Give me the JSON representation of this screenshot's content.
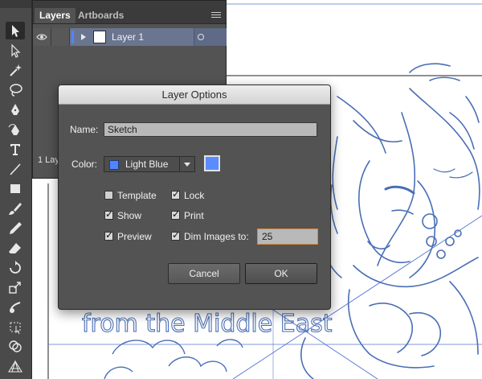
{
  "colors": {
    "accent": "#4f86ff",
    "sketch": "#4a6fb5",
    "panel_bg": "#535353",
    "layer_row": "#6a7590"
  },
  "tools_panel": {
    "tools": [
      "selection-tool-icon",
      "direct-selection-tool-icon",
      "magic-wand-tool-icon",
      "lasso-tool-icon",
      "pen-tool-icon",
      "curvature-pen-tool-icon",
      "type-tool-icon",
      "line-tool-icon",
      "rectangle-tool-icon",
      "paintbrush-tool-icon",
      "pencil-tool-icon",
      "eraser-tool-icon",
      "rotate-tool-icon",
      "scale-tool-icon",
      "warp-tool-icon",
      "free-transform-tool-icon",
      "shape-builder-tool-icon",
      "perspective-grid-tool-icon"
    ]
  },
  "layers_panel": {
    "tabs": [
      "Layers",
      "Artboards"
    ],
    "menu_icon": "panel-menu-icon",
    "layer_name": "Layer 1",
    "layer_count": "1 Lay"
  },
  "artwork": {
    "caption": "from the Middle East"
  },
  "dialog": {
    "title": "Layer Options",
    "name_label": "Name:",
    "name_value": "Sketch",
    "color_label": "Color:",
    "color_value": "Light Blue",
    "options": {
      "template": {
        "label": "Template",
        "checked": false
      },
      "lock": {
        "label": "Lock",
        "checked": true
      },
      "show": {
        "label": "Show",
        "checked": true
      },
      "print": {
        "label": "Print",
        "checked": true
      },
      "preview": {
        "label": "Preview",
        "checked": true
      },
      "dim": {
        "label": "Dim Images to:",
        "checked": true
      }
    },
    "dim_value": "25",
    "cancel_label": "Cancel",
    "ok_label": "OK"
  }
}
